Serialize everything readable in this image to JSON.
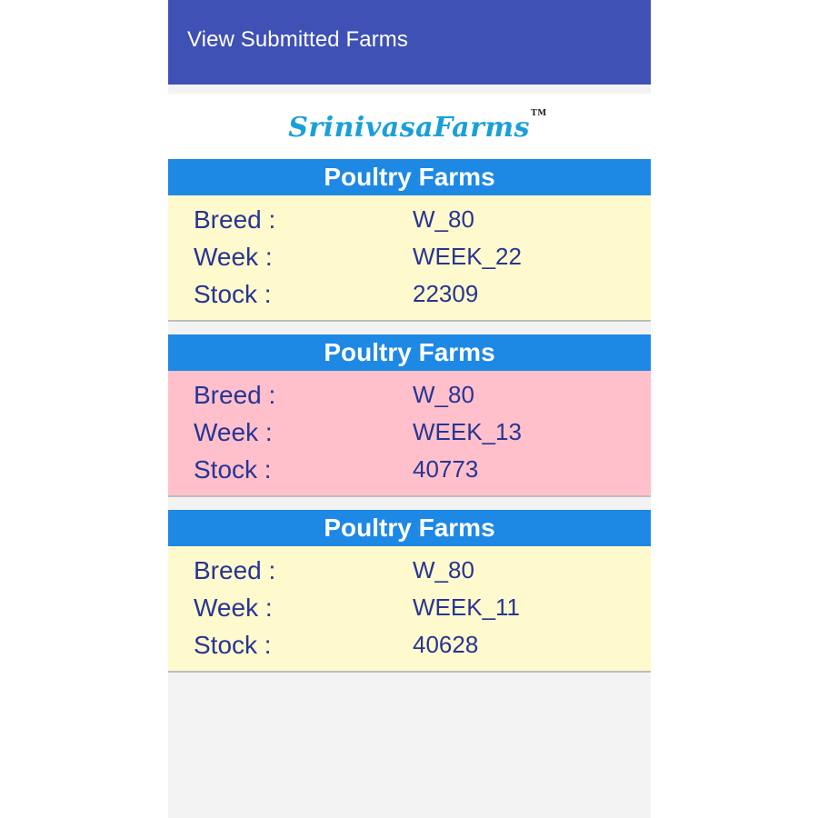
{
  "app": {
    "title": "View Submitted Farms"
  },
  "logo": {
    "text": "SrinivasaFarms",
    "trademark": "TM"
  },
  "farms": [
    {
      "header": "Poultry Farms",
      "background": "#fffacd",
      "breed_label": "Breed :",
      "breed": "W_80",
      "week_label": "Week :",
      "week": "WEEK_22",
      "stock_label": "Stock :",
      "stock": "22309"
    },
    {
      "header": "Poultry Farms",
      "background": "#ffc0cb",
      "breed_label": "Breed :",
      "breed": "W_80",
      "week_label": "Week :",
      "week": "WEEK_13",
      "stock_label": "Stock :",
      "stock": "40773"
    },
    {
      "header": "Poultry Farms",
      "background": "#fffacd",
      "breed_label": "Breed :",
      "breed": "W_80",
      "week_label": "Week :",
      "week": "WEEK_11",
      "stock_label": "Stock :",
      "stock": "40628"
    }
  ],
  "colors": {
    "appbar": "#3f51b5",
    "card_header": "#1e88e5",
    "text": "#283593",
    "logo": "#1aa0d8"
  }
}
